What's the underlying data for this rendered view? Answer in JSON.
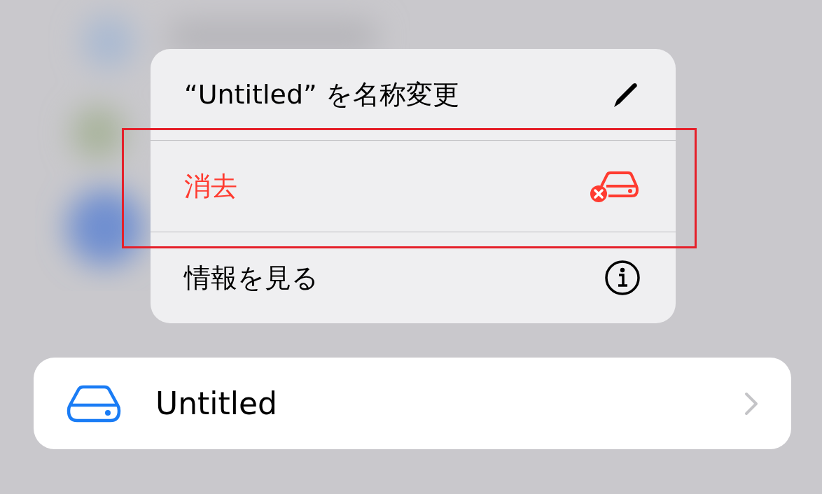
{
  "context_menu": {
    "items": [
      {
        "kind": "rename",
        "label": "“Untitled” を名称変更",
        "destructive": false,
        "highlighted": false
      },
      {
        "kind": "erase",
        "label": "消去",
        "destructive": true,
        "highlighted": true
      },
      {
        "kind": "info",
        "label": "情報を見る",
        "destructive": false,
        "highlighted": false
      }
    ]
  },
  "drive_row": {
    "name": "Untitled"
  }
}
